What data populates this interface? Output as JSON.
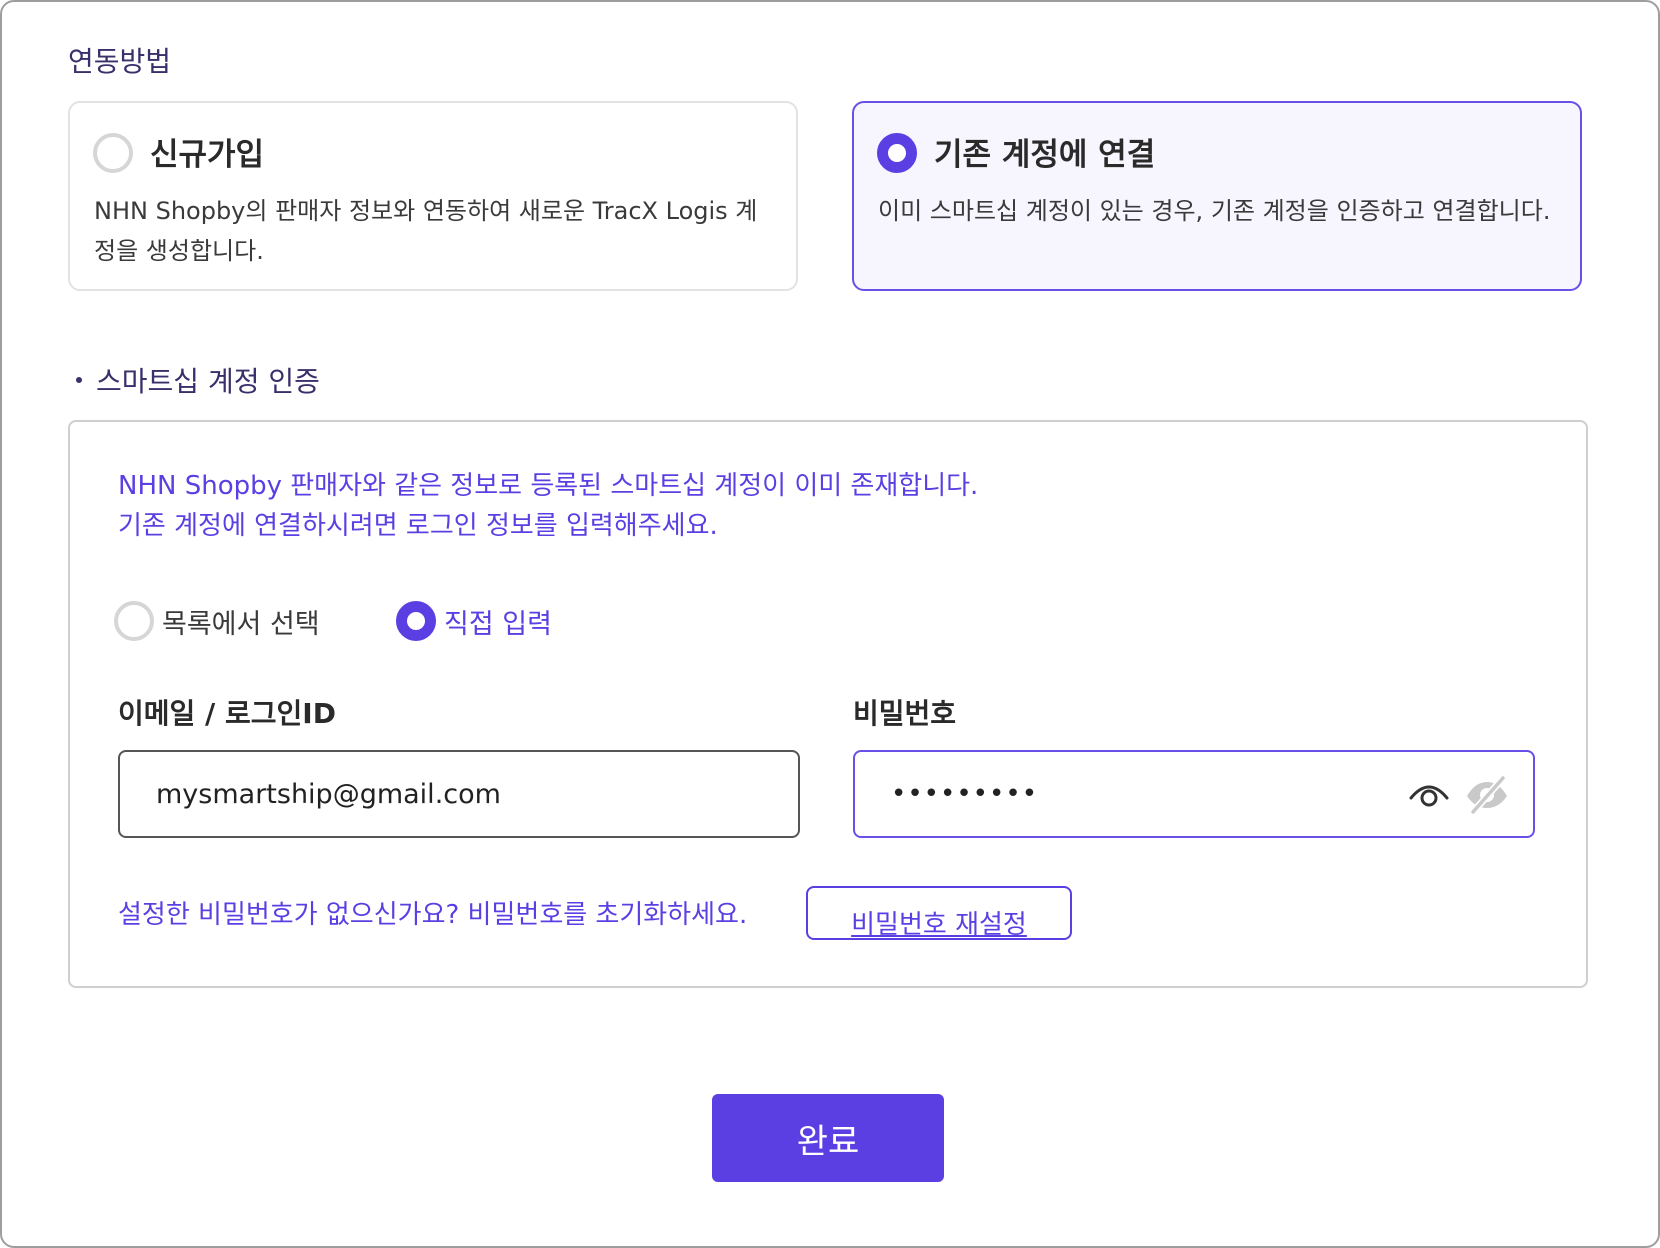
{
  "link_method": {
    "title": "연동방법",
    "options": [
      {
        "title": "신규가입",
        "description": "NHN Shopby의 판매자 정보와 연동하여 새로운 TracX Logis 계정을 생성합니다.",
        "selected": false
      },
      {
        "title": "기존 계정에 연결",
        "description": "이미 스마트십 계정이 있는 경우, 기존 계정을 인증하고 연결합니다.",
        "selected": true
      }
    ]
  },
  "auth": {
    "title": "스마트십 계정 인증",
    "notice_line1": "NHN Shopby 판매자와 같은 정보로 등록된 스마트십 계정이 이미 존재합니다.",
    "notice_line2": "기존 계정에 연결하시려면 로그인 정보를 입력해주세요.",
    "modes": [
      {
        "label": "목록에서 선택",
        "selected": false
      },
      {
        "label": "직접 입력",
        "selected": true
      }
    ],
    "email_label": "이메일 / 로그인ID",
    "email_value": "mysmartship@gmail.com",
    "password_label": "비밀번호",
    "password_value": "•••••••••",
    "reset_hint": "설정한 비밀번호가 없으신가요? 비밀번호를 초기화하세요.",
    "reset_button": "비밀번호 재설정"
  },
  "footer": {
    "done_button": "완료"
  },
  "colors": {
    "accent": "#5b3fe3",
    "selected_card_bg": "#f7f5fd",
    "heading": "#3a2f6b"
  },
  "icons": {
    "show_password": "eye-icon",
    "hide_password": "eye-off-icon"
  }
}
